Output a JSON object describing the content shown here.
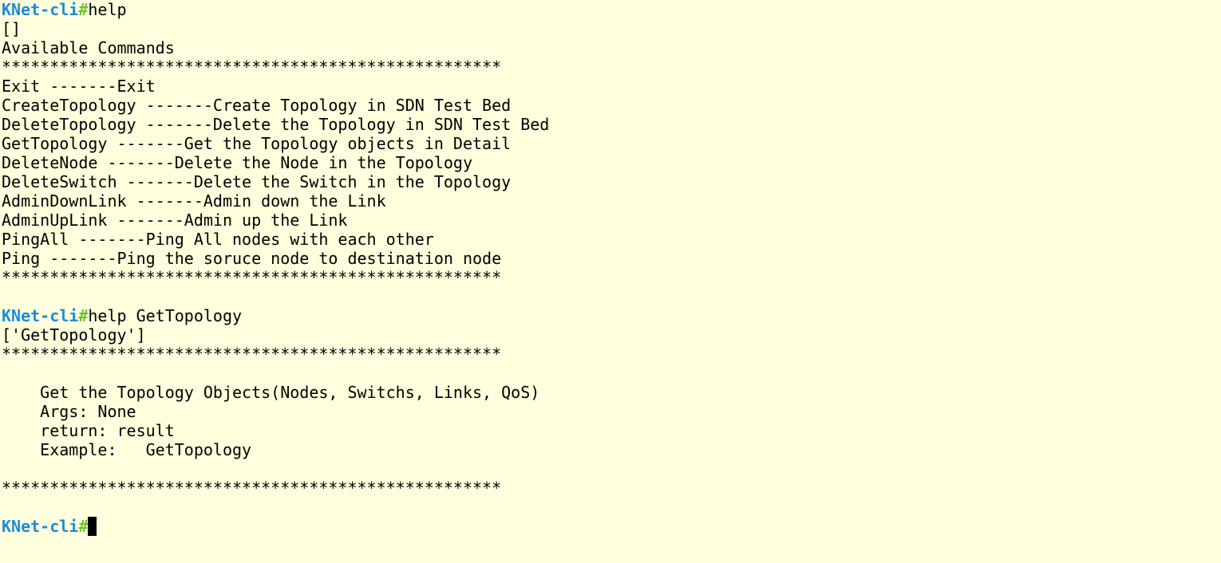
{
  "terminal": {
    "prompt": {
      "name": "KNet-cli",
      "symbol": "#"
    },
    "colors": {
      "background": "#FFFFDD",
      "text": "#000000",
      "prompt_name": "#1E8CD7",
      "prompt_symbol": "#6BC42D",
      "cursor": "#000000"
    },
    "session": [
      {
        "command": "help"
      },
      {
        "output": "[]"
      },
      {
        "output": "Available Commands"
      },
      {
        "output": "****************************************************"
      },
      {
        "output": "Exit -------Exit"
      },
      {
        "output": "CreateTopology -------Create Topology in SDN Test Bed"
      },
      {
        "output": "DeleteTopology -------Delete the Topology in SDN Test Bed"
      },
      {
        "output": "GetTopology -------Get the Topology objects in Detail"
      },
      {
        "output": "DeleteNode -------Delete the Node in the Topology"
      },
      {
        "output": "DeleteSwitch -------Delete the Switch in the Topology"
      },
      {
        "output": "AdminDownLink -------Admin down the Link"
      },
      {
        "output": "AdminUpLink -------Admin up the Link"
      },
      {
        "output": "PingAll -------Ping All nodes with each other"
      },
      {
        "output": "Ping -------Ping the soruce node to destination node"
      },
      {
        "output": "****************************************************"
      },
      {
        "output": ""
      },
      {
        "command": "help GetTopology"
      },
      {
        "output": "['GetTopology']"
      },
      {
        "output": "****************************************************"
      },
      {
        "output": ""
      },
      {
        "output": "    Get the Topology Objects(Nodes, Switchs, Links, QoS)"
      },
      {
        "output": "    Args: None"
      },
      {
        "output": "    return: result"
      },
      {
        "output": "    Example:   GetTopology"
      },
      {
        "output": ""
      },
      {
        "output": "****************************************************"
      },
      {
        "output": ""
      }
    ],
    "current_input": ""
  }
}
